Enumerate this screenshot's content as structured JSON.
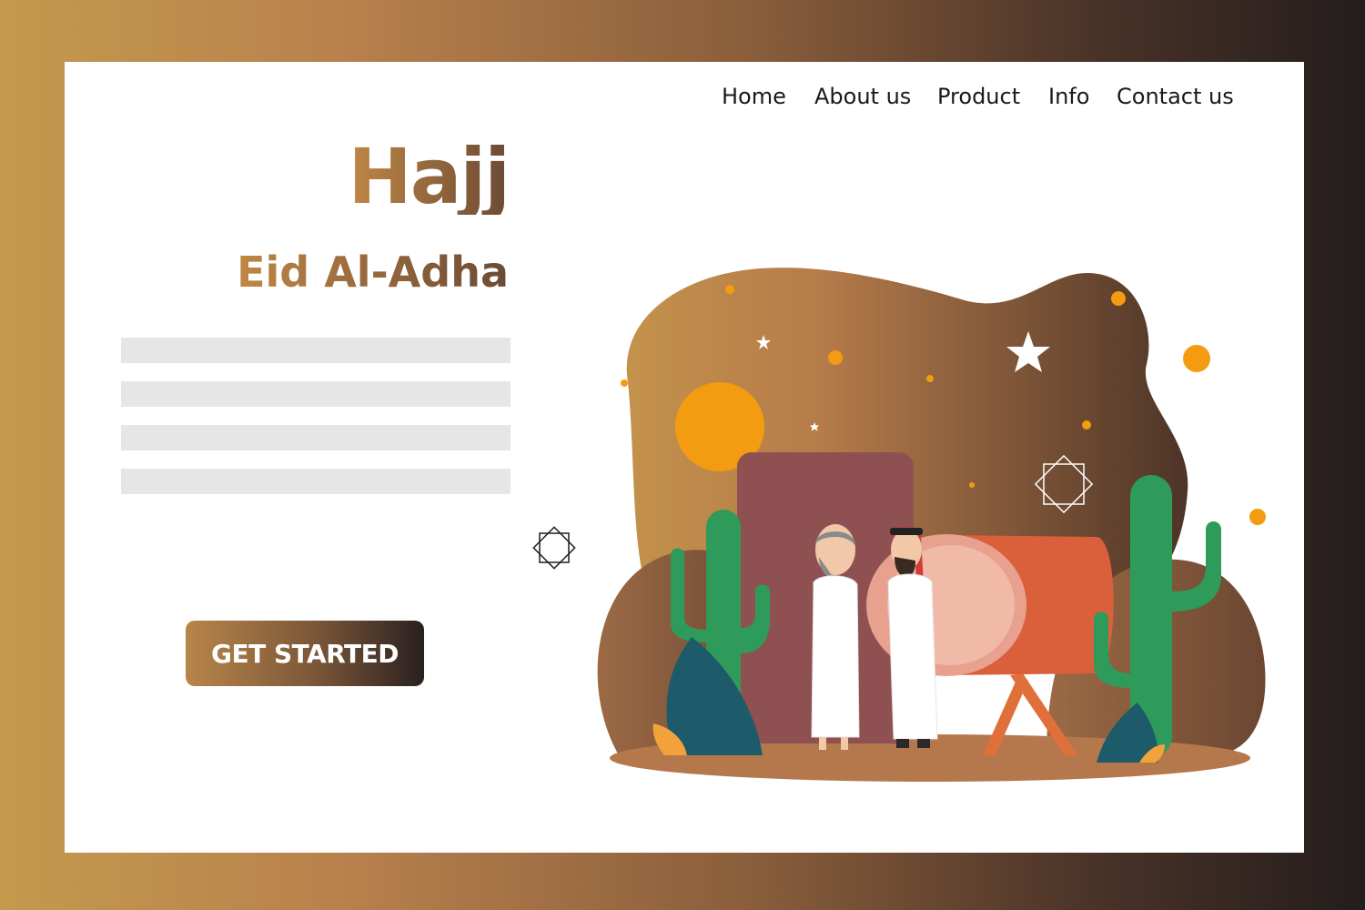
{
  "nav": {
    "items": [
      {
        "label": "Home"
      },
      {
        "label": "About us"
      },
      {
        "label": "Product"
      },
      {
        "label": "Info"
      },
      {
        "label": "Contact us"
      }
    ]
  },
  "hero": {
    "title": "Hajj",
    "subtitle": "Eid Al-Adha",
    "cta_label": "GET STARTED"
  },
  "colors": {
    "accent_gold": "#c08745",
    "accent_brown": "#6b4a35",
    "text_placeholder": "#e6e6e6",
    "cactus": "#2f9b5a",
    "orange": "#f39c12"
  },
  "illustration": {
    "icons": [
      "crescent-star-icon",
      "geometric-star-icon",
      "sun-icon",
      "cactus-icon",
      "drum-icon"
    ]
  }
}
